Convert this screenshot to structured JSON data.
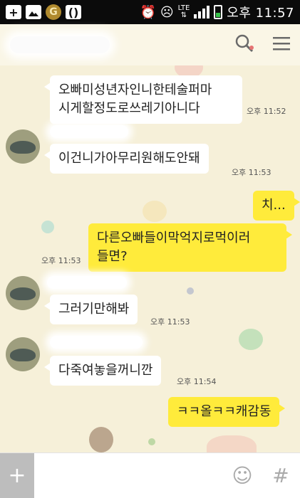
{
  "status_bar": {
    "left_icons": [
      "plus-box-icon",
      "image-icon",
      "g-app-icon",
      "brackets-app-icon"
    ],
    "right_icons": [
      "alarm-icon",
      "face-icon",
      "lte-icon",
      "signal-icon",
      "battery-icon"
    ],
    "lte": "LTE",
    "time": "오후 11:57"
  },
  "header": {
    "icons": [
      "search-icon",
      "menu-icon"
    ]
  },
  "messages": [
    {
      "id": "m1",
      "from": "them",
      "text": "오빠미성년자인니한테술퍼마\n시게할정도로쓰레기아니다",
      "time": "오후 11:52"
    },
    {
      "id": "m2",
      "from": "them",
      "text": "이건니가아무리원해도안돼",
      "time": "오후 11:53"
    },
    {
      "id": "m3",
      "from": "me",
      "text": "치...",
      "time": ""
    },
    {
      "id": "m4",
      "from": "me",
      "text": "다른오빠들이막억지로먹이러\n들면?",
      "time": "오후 11:53"
    },
    {
      "id": "m5",
      "from": "them",
      "text": "그러기만해봐",
      "time": "오후 11:53"
    },
    {
      "id": "m6",
      "from": "them",
      "text": "다죽여놓을꺼니깐",
      "time": "오후 11:54"
    },
    {
      "id": "m7",
      "from": "me",
      "text": "ㅋㅋ올ㅋㅋ캐감동",
      "time": ""
    }
  ],
  "input_bar": {
    "plus": "+",
    "emoji": "☺",
    "hash": "#",
    "placeholder": ""
  },
  "colors": {
    "my_bubble": "#ffeb3b",
    "their_bubble": "#ffffff",
    "background": "#f6f0d9"
  }
}
